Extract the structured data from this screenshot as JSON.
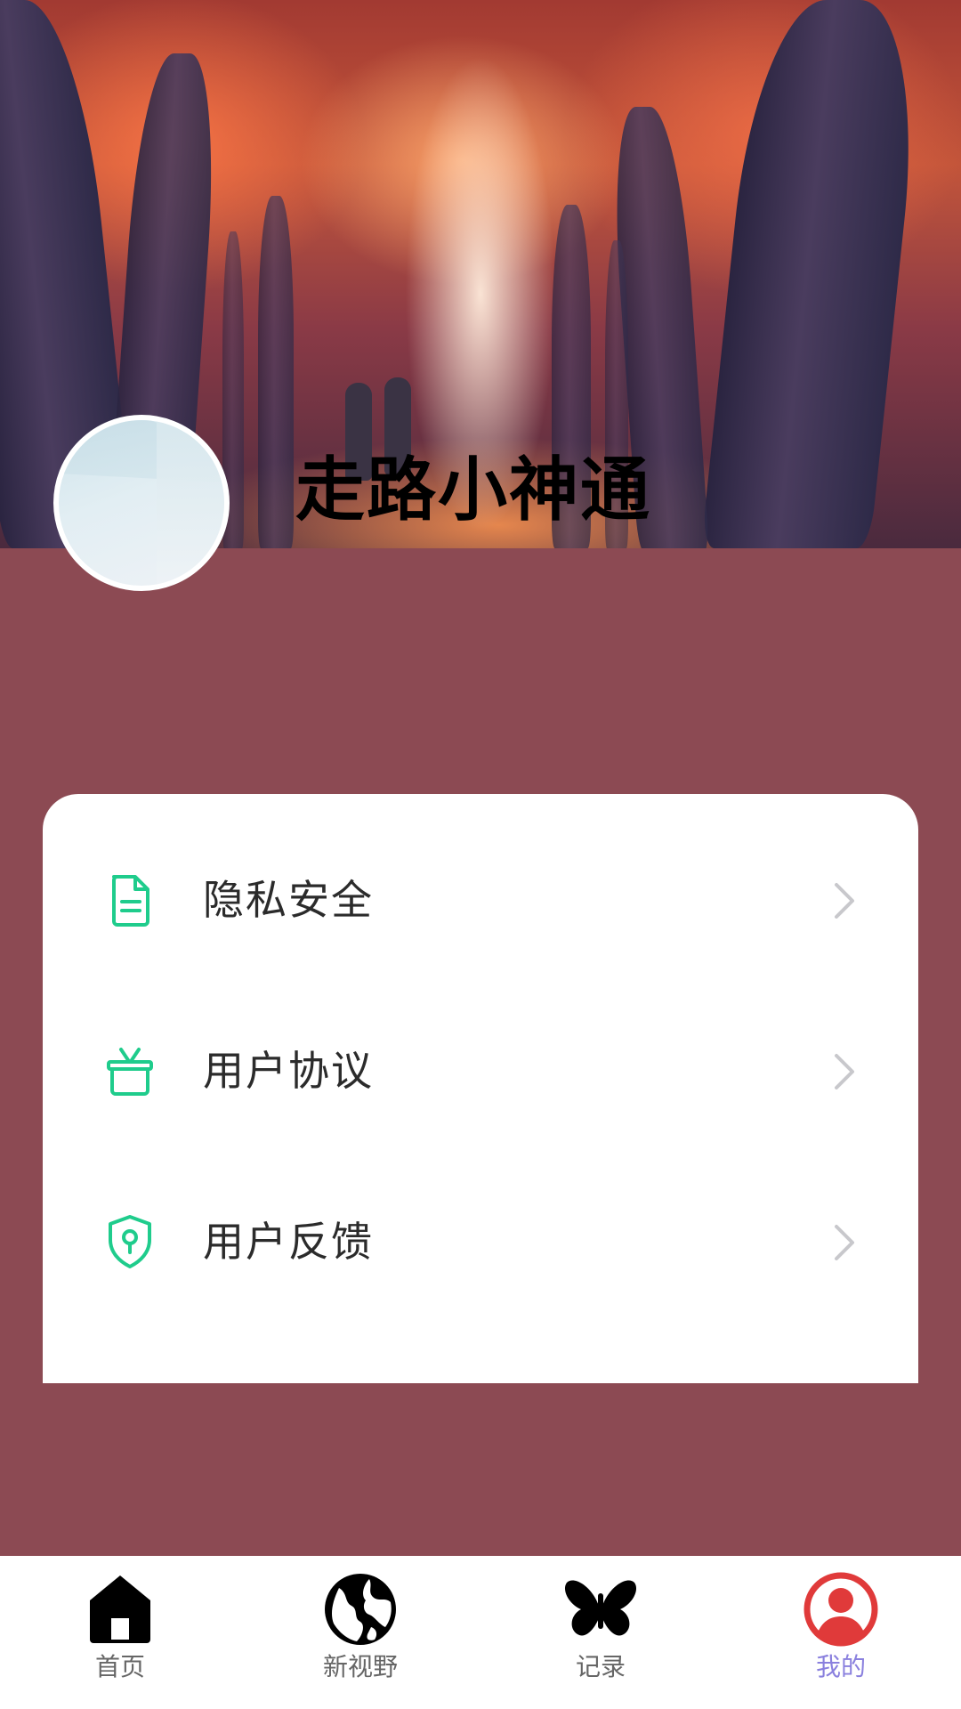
{
  "header": {
    "title": "走路小神通",
    "avatar_icon": "avatar"
  },
  "menu": {
    "items": [
      {
        "label": "隐私安全",
        "icon": "document-icon",
        "chevron": "chevron-right-icon"
      },
      {
        "label": "用户协议",
        "icon": "gift-box-icon",
        "chevron": "chevron-right-icon"
      },
      {
        "label": "用户反馈",
        "icon": "shield-key-icon",
        "chevron": "chevron-right-icon"
      }
    ]
  },
  "tabbar": {
    "tabs": [
      {
        "label": "首页",
        "icon": "home-icon",
        "active": false
      },
      {
        "label": "新视野",
        "icon": "globe-icon",
        "active": false
      },
      {
        "label": "记录",
        "icon": "butterfly-icon",
        "active": false
      },
      {
        "label": "我的",
        "icon": "user-circle-icon",
        "active": true
      }
    ]
  },
  "colors": {
    "page_background": "#8c4a53",
    "card_background": "#ffffff",
    "menu_icon_accent": "#1fcc8c",
    "chevron": "#c8c8cc",
    "active_tab_label": "#8a80de",
    "active_tab_icon": "#e03a3a",
    "inactive_tab_label": "#666666"
  }
}
